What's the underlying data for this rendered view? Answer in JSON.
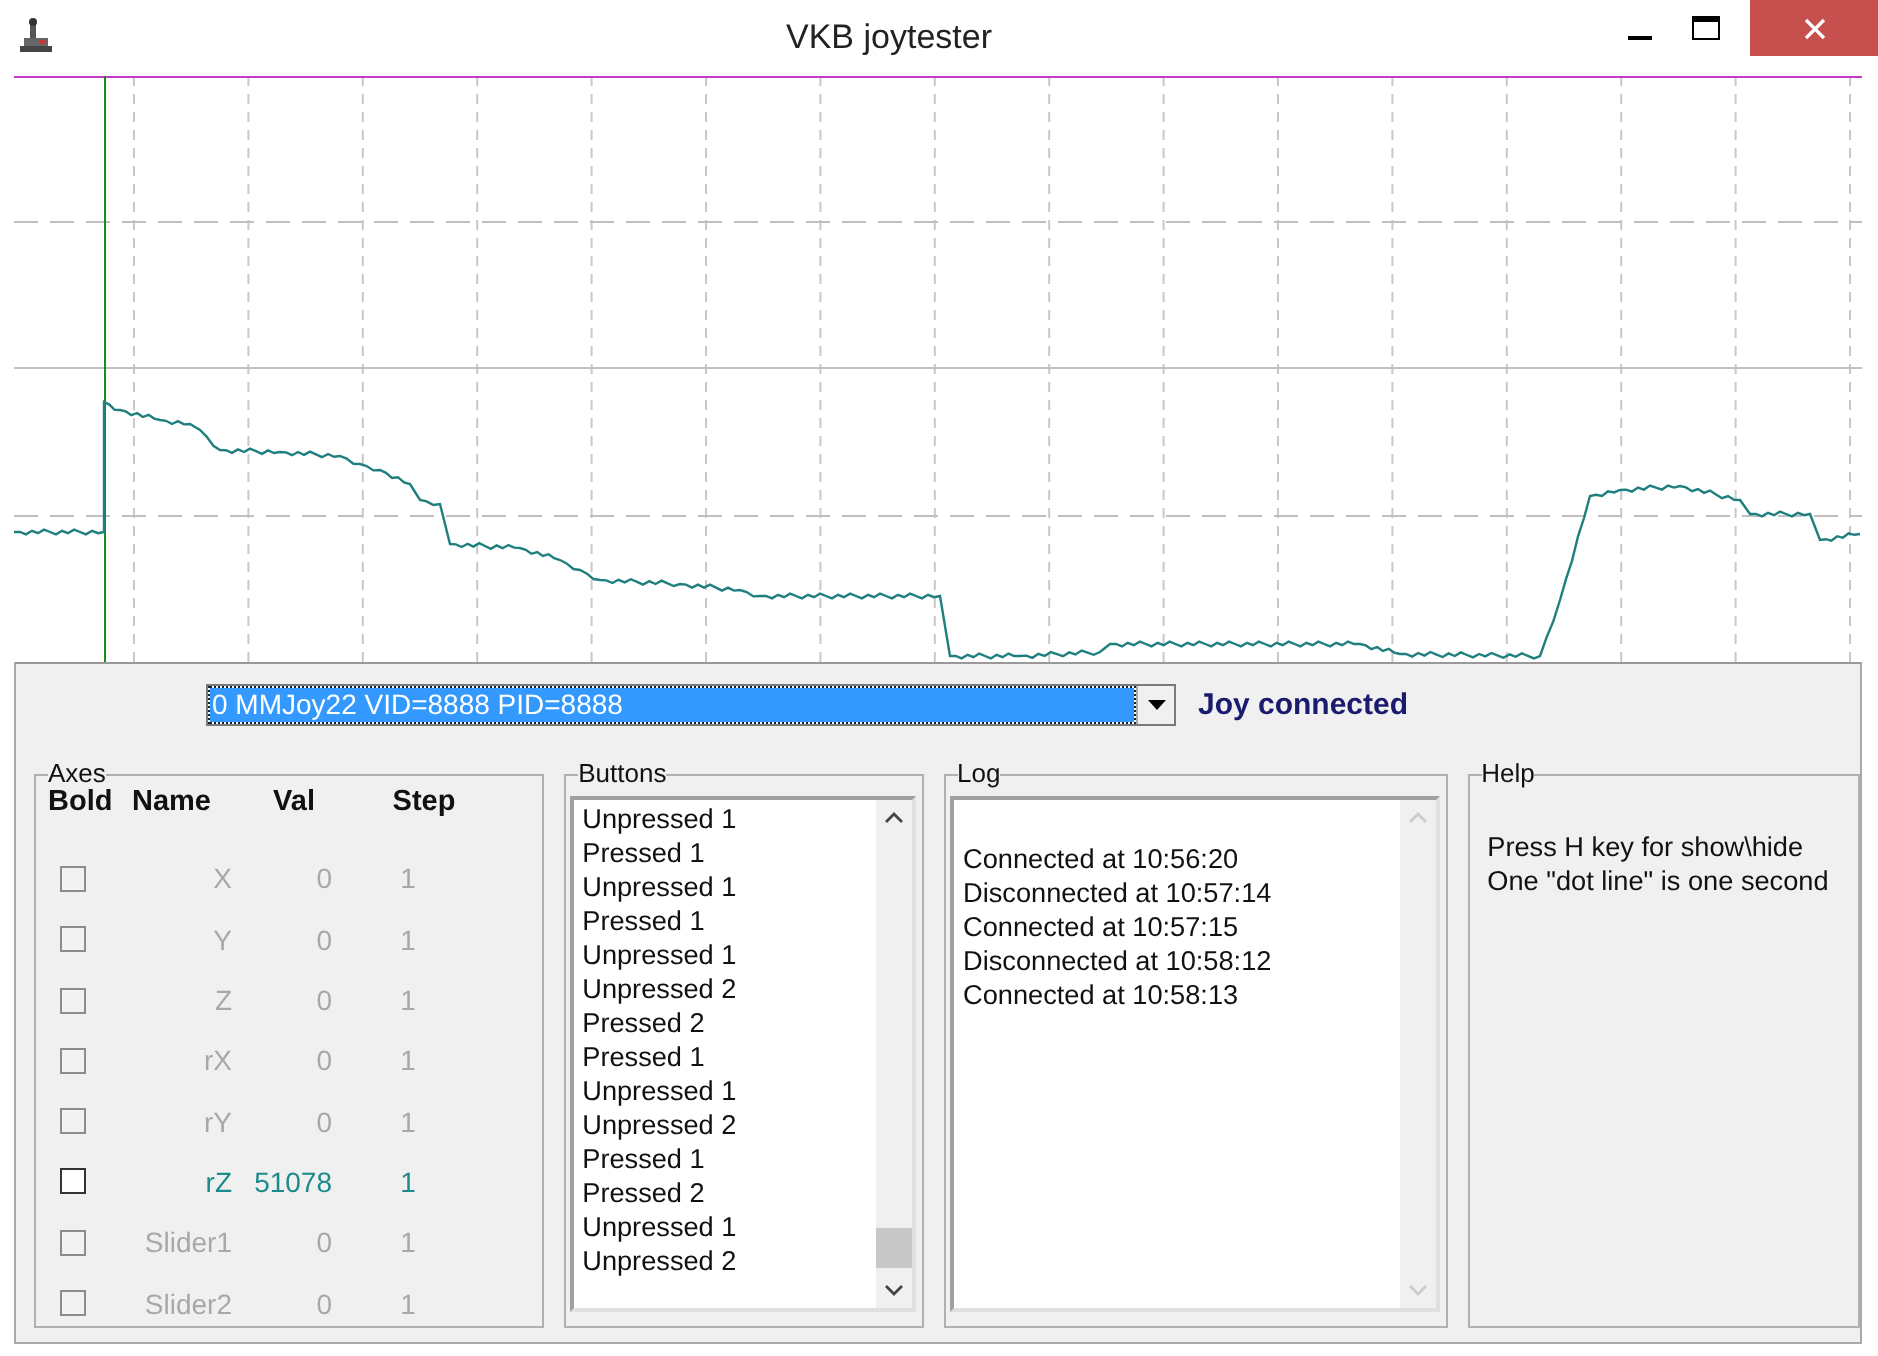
{
  "window": {
    "title": "VKB joytester"
  },
  "device": {
    "value": "0 MMJoy22 VID=8888 PID=8888",
    "status": "Joy connected"
  },
  "axes": {
    "title": "Axes",
    "columns": [
      "Bold",
      "Name",
      "Val",
      "Step"
    ],
    "rows": [
      {
        "name": "X",
        "val": "0",
        "step": "1",
        "checked": false,
        "disabled": true
      },
      {
        "name": "Y",
        "val": "0",
        "step": "1",
        "checked": false,
        "disabled": true
      },
      {
        "name": "Z",
        "val": "0",
        "step": "1",
        "checked": false,
        "disabled": true
      },
      {
        "name": "rX",
        "val": "0",
        "step": "1",
        "checked": false,
        "disabled": true
      },
      {
        "name": "rY",
        "val": "0",
        "step": "1",
        "checked": false,
        "disabled": true
      },
      {
        "name": "rZ",
        "val": "51078",
        "step": "1",
        "checked": false,
        "disabled": false
      },
      {
        "name": "Slider1",
        "val": "0",
        "step": "1",
        "checked": false,
        "disabled": true
      },
      {
        "name": "Slider2",
        "val": "0",
        "step": "1",
        "checked": false,
        "disabled": true
      }
    ]
  },
  "buttons": {
    "title": "Buttons",
    "entries": [
      "Unpressed 1",
      "Pressed 1",
      "Unpressed 1",
      "Pressed 1",
      "Unpressed 1",
      "Unpressed 2",
      "Pressed 2",
      "Pressed 1",
      "Unpressed 1",
      "Unpressed 2",
      "Pressed 1",
      "Pressed 2",
      "Unpressed 1",
      "Unpressed 2"
    ]
  },
  "log": {
    "title": "Log",
    "entries": [
      "Connected at 10:56:20",
      "Disconnected at 10:57:14",
      "Connected at 10:57:15",
      "Disconnected at 10:58:12",
      "Connected at 10:58:13"
    ]
  },
  "help": {
    "title": "Help",
    "lines": [
      "Press H key for show\\hide",
      "One \"dot line\" is one second"
    ]
  }
}
